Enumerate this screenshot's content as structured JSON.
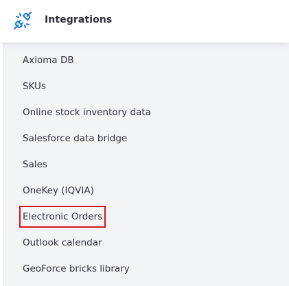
{
  "header": {
    "title": "Integrations",
    "icon": "plug-connection-icon",
    "icon_color": "#1f7bd8"
  },
  "menu": {
    "items": [
      {
        "label": "Axioma DB"
      },
      {
        "label": "SKUs"
      },
      {
        "label": "Online stock inventory data"
      },
      {
        "label": "Salesforce data bridge"
      },
      {
        "label": "Sales"
      },
      {
        "label": "OneKey (IQVIA)"
      },
      {
        "label": "Electronic Orders",
        "highlighted": true
      },
      {
        "label": "Outlook calendar"
      },
      {
        "label": "GeoForce bricks library"
      }
    ],
    "highlight_color": "#d0161b"
  }
}
